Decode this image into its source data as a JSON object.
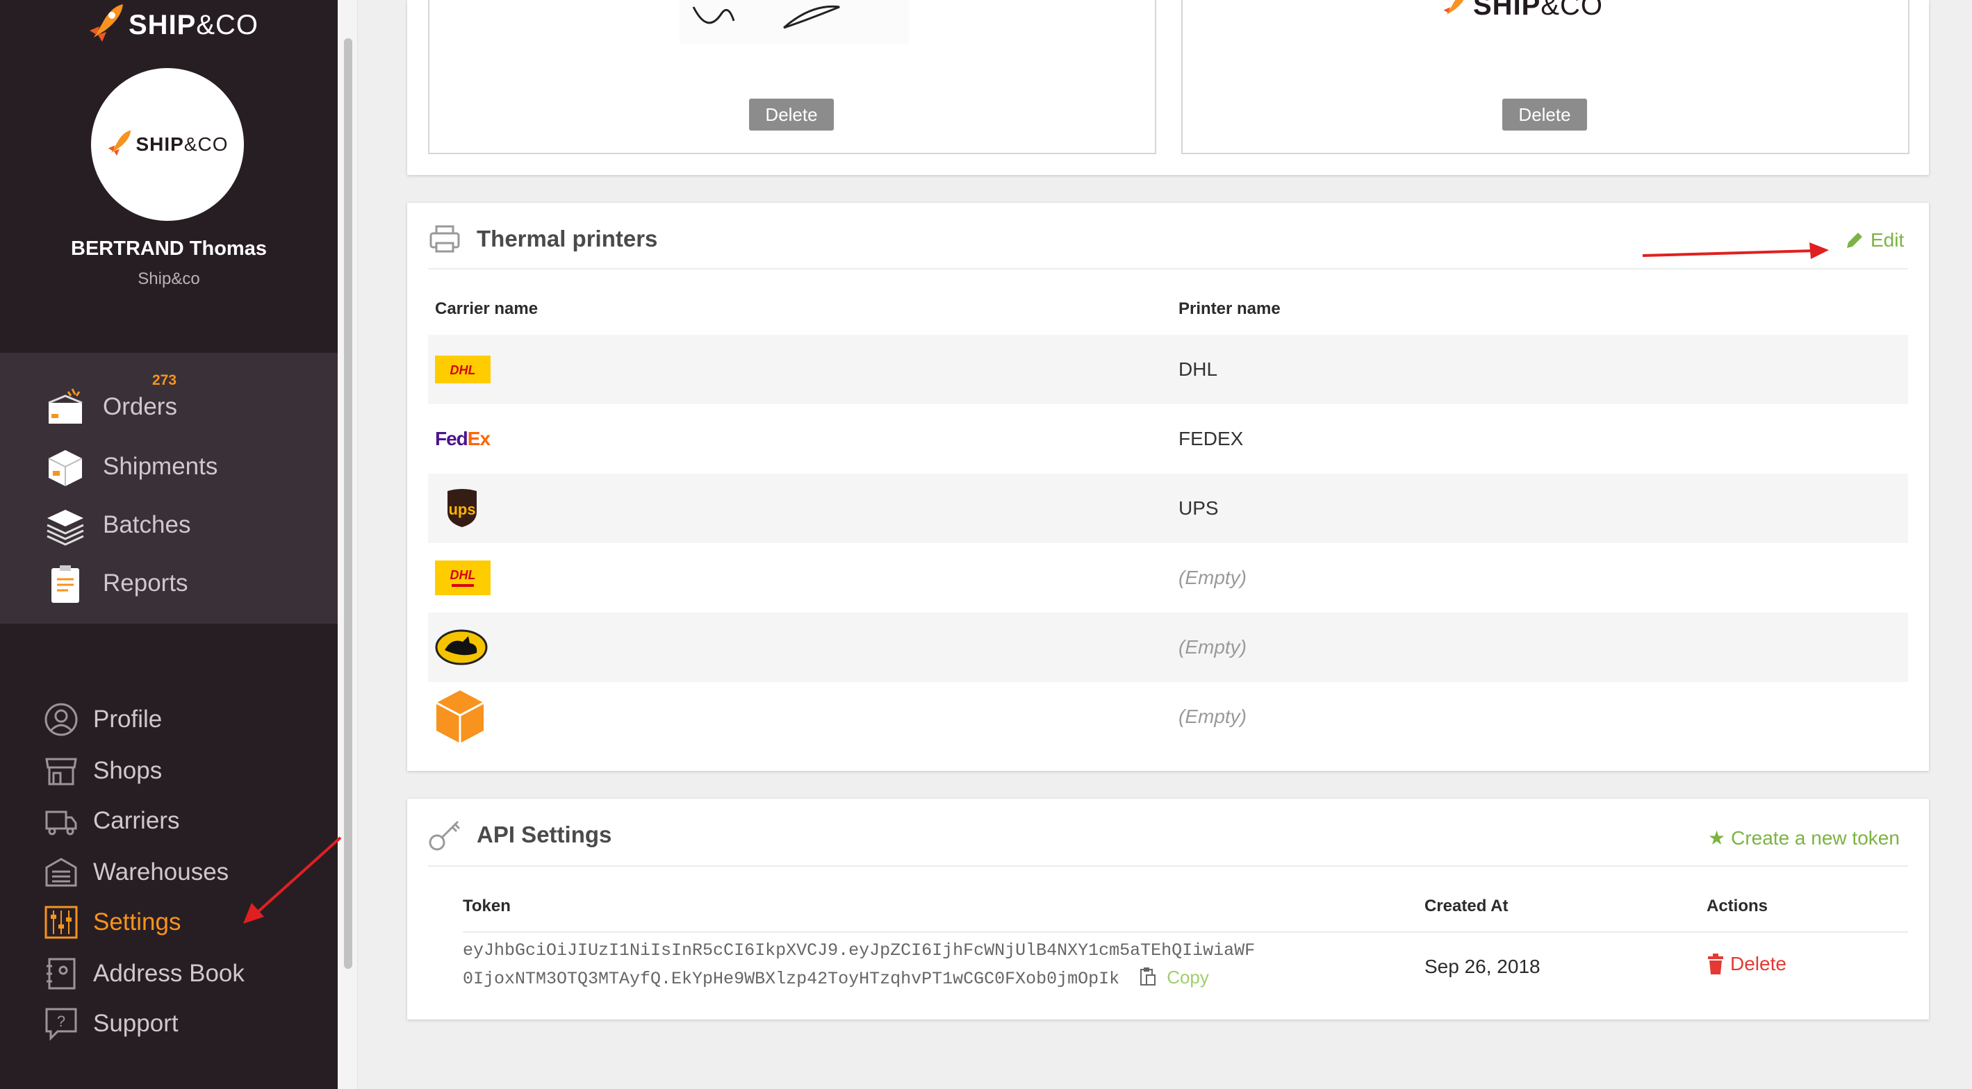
{
  "brand": {
    "name_bold": "SHIP",
    "name_rest": "&CO"
  },
  "user": {
    "name": "BERTRAND Thomas",
    "company": "Ship&co"
  },
  "nav_main": [
    {
      "label": "Orders",
      "icon": "orders-box-icon",
      "badge": "273"
    },
    {
      "label": "Shipments",
      "icon": "shipment-box-icon"
    },
    {
      "label": "Batches",
      "icon": "batch-stack-icon"
    },
    {
      "label": "Reports",
      "icon": "clipboard-report-icon"
    }
  ],
  "nav_secondary": [
    {
      "label": "Profile",
      "icon": "user-circle-icon"
    },
    {
      "label": "Shops",
      "icon": "storefront-icon"
    },
    {
      "label": "Carriers",
      "icon": "truck-icon"
    },
    {
      "label": "Warehouses",
      "icon": "warehouse-icon"
    },
    {
      "label": "Settings",
      "icon": "sliders-icon",
      "active": true
    },
    {
      "label": "Address Book",
      "icon": "address-book-icon"
    },
    {
      "label": "Support",
      "icon": "help-bubble-icon"
    }
  ],
  "top_cards": [
    {
      "delete_label": "Delete"
    },
    {
      "delete_label": "Delete"
    }
  ],
  "thermal": {
    "title": "Thermal printers",
    "edit_label": "Edit",
    "columns": [
      "Carrier name",
      "Printer name"
    ],
    "rows": [
      {
        "carrier_logo": "dhl-logo",
        "printer": "DHL"
      },
      {
        "carrier_logo": "fedex-logo",
        "printer": "FEDEX",
        "logo_text_a": "Fed",
        "logo_text_b": "Ex"
      },
      {
        "carrier_logo": "ups-logo",
        "printer": "UPS",
        "logo_text": "ups"
      },
      {
        "carrier_logo": "dhl-ecommerce-logo",
        "printer": "(Empty)"
      },
      {
        "carrier_logo": "yamato-cat-logo",
        "printer": "(Empty)"
      },
      {
        "carrier_logo": "generic-box-logo",
        "printer": "(Empty)"
      }
    ]
  },
  "api": {
    "title": "API Settings",
    "create_label": "Create a new token",
    "columns": [
      "Token",
      "Created At",
      "Actions"
    ],
    "token_line1": "eyJhbGciOiJIUzI1NiIsInR5cCI6IkpXVCJ9.eyJpZCI6IjhFcWNjUlB4NXY1cm5aTEhQIiwiaWF",
    "token_line2": "0IjoxNTM3OTQ3MTAyfQ.EkYpHe9WBXlzp42ToyHTzqhvPT1wCGC0FXob0jmOpIk",
    "copy_label": "Copy",
    "created_at": "Sep 26, 2018",
    "delete_label": "Delete"
  },
  "colors": {
    "sidebar": "#271e24",
    "accent_orange": "#f7931e",
    "green": "#7cb342",
    "red": "#e53935",
    "annotation_arrow": "#e02020"
  }
}
